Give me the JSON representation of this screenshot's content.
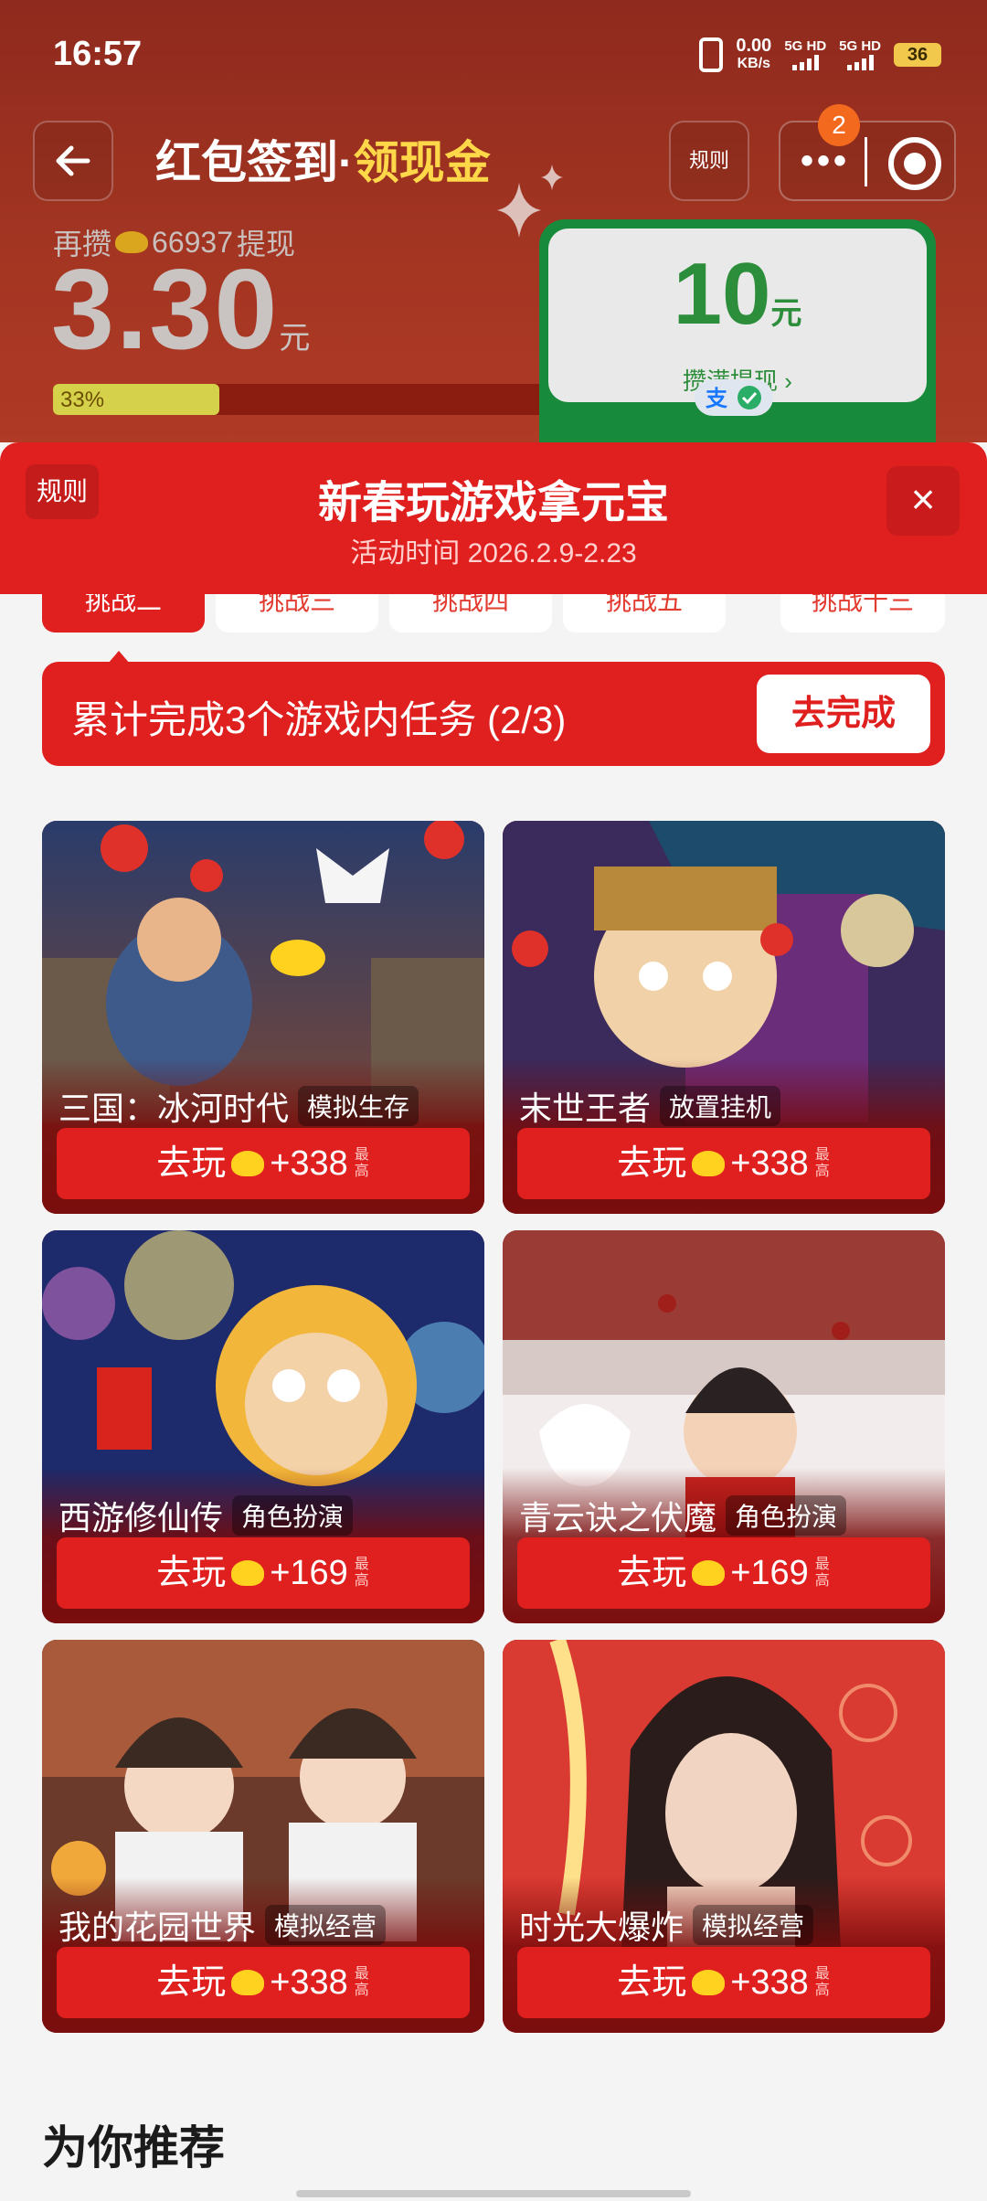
{
  "status": {
    "time": "16:57",
    "net_speed": "0.00",
    "net_unit": "KB/s",
    "sim1": "5G HD",
    "sim2": "5G HD",
    "battery": "36"
  },
  "header": {
    "title_main": "红包签到",
    "title_dot": "·",
    "title_highlight": "领现金",
    "rules": "规则",
    "notification_count": "2"
  },
  "balance": {
    "remain_prefix": "再攒",
    "remain_coins": "66937",
    "remain_suffix": "提现",
    "amount": "3.30",
    "unit": "元",
    "progress_label": "33%",
    "progress_value": 0.33
  },
  "withdraw_card": {
    "amount": "10",
    "unit": "元",
    "label": "攒满提现 ›"
  },
  "event": {
    "rules": "规则",
    "title": "新春玩游戏拿元宝",
    "time": "活动时间 2026.2.9-2.23",
    "close": "×"
  },
  "tabs": [
    "挑战二",
    "挑战三",
    "挑战四",
    "挑战五",
    "挑战十三"
  ],
  "task": {
    "text": "累计完成3个游戏内任务 (2/3)",
    "button": "去完成"
  },
  "games": [
    {
      "name": "三国：冰河时代",
      "genre": "模拟生存",
      "play": "去玩",
      "reward": "+338",
      "max": "最高"
    },
    {
      "name": "末世王者",
      "genre": "放置挂机",
      "play": "去玩",
      "reward": "+338",
      "max": "最高"
    },
    {
      "name": "西游修仙传",
      "genre": "角色扮演",
      "play": "去玩",
      "reward": "+169",
      "max": "最高"
    },
    {
      "name": "青云诀之伏魔",
      "genre": "角色扮演",
      "play": "去玩",
      "reward": "+169",
      "max": "最高"
    },
    {
      "name": "我的花园世界",
      "genre": "模拟经营",
      "play": "去玩",
      "reward": "+338",
      "max": "最高"
    },
    {
      "name": "时光大爆炸",
      "genre": "模拟经营",
      "play": "去玩",
      "reward": "+338",
      "max": "最高"
    }
  ],
  "recommend": {
    "title": "为你推荐"
  },
  "colors": {
    "accent": "#e01f1f",
    "header_bg": "#a33522",
    "green": "#188a3b",
    "gold": "#ffd84a"
  }
}
